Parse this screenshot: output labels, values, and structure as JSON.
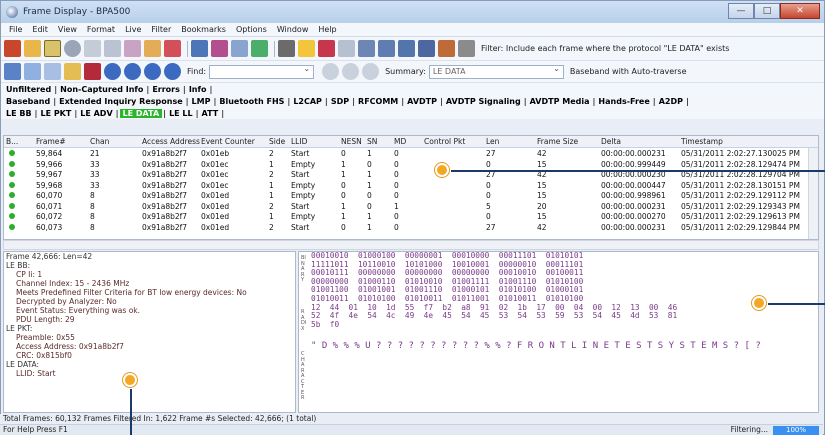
{
  "window": {
    "title": "Frame Display - BPA500"
  },
  "menu": [
    "File",
    "Edit",
    "View",
    "Format",
    "Live",
    "Filter",
    "Bookmarks",
    "Options",
    "Window",
    "Help"
  ],
  "toolbar": {
    "filter_text": "Filter: Include each frame where the protocol \"LE DATA\" exists",
    "find_label": "Find:",
    "summary_label": "Summary:",
    "summary_value": "LE DATA",
    "baseband_text": "Baseband with Auto-traverse"
  },
  "tabs_row1": [
    "Unfiltered",
    "Non-Captured Info",
    "Errors",
    "Info"
  ],
  "tabs_row2": [
    "Baseband",
    "Extended Inquiry Response",
    "LMP",
    "Bluetooth FHS",
    "L2CAP",
    "SDP",
    "RFCOMM",
    "AVDTP",
    "AVDTP Signaling",
    "AVDTP Media",
    "Hands-Free",
    "A2DP"
  ],
  "tabs_row3": [
    "LE BB",
    "LE PKT",
    "LE ADV",
    "LE DATA",
    "LE LL",
    "ATT"
  ],
  "tabs_row3_active": "LE DATA",
  "grid": {
    "columns": [
      "B...",
      "Frame#",
      "Chan",
      "Access Address",
      "Event Counter",
      "Side",
      "LLID",
      "NESN",
      "SN",
      "MD",
      "Control Pkt",
      "Len",
      "Frame Size",
      "Delta",
      "Timestamp"
    ],
    "rows": [
      [
        "59,864",
        "21",
        "0x91a8b2f7",
        "0x01eb",
        "2",
        "Start",
        "0",
        "1",
        "0",
        "",
        "27",
        "42",
        "00:00:00.000231",
        "05/31/2011 2:02:27.130025 PM"
      ],
      [
        "59,966",
        "33",
        "0x91a8b2f7",
        "0x01ec",
        "1",
        "Empty",
        "1",
        "0",
        "0",
        "",
        "0",
        "15",
        "00:00:00.999449",
        "05/31/2011 2:02:28.129474 PM"
      ],
      [
        "59,967",
        "33",
        "0x91a8b2f7",
        "0x01ec",
        "2",
        "Start",
        "1",
        "1",
        "0",
        "",
        "27",
        "42",
        "00:00:00.000230",
        "05/31/2011 2:02:28.129704 PM"
      ],
      [
        "59,968",
        "33",
        "0x91a8b2f7",
        "0x01ec",
        "1",
        "Empty",
        "0",
        "1",
        "0",
        "",
        "0",
        "15",
        "00:00:00.000447",
        "05/31/2011 2:02:28.130151 PM"
      ],
      [
        "60,070",
        "8",
        "0x91a8b2f7",
        "0x01ed",
        "1",
        "Empty",
        "0",
        "0",
        "0",
        "",
        "0",
        "15",
        "00:00:00.998961",
        "05/31/2011 2:02:29.129112 PM"
      ],
      [
        "60,071",
        "8",
        "0x91a8b2f7",
        "0x01ed",
        "2",
        "Start",
        "1",
        "0",
        "1",
        "",
        "5",
        "20",
        "00:00:00.000231",
        "05/31/2011 2:02:29.129343 PM"
      ],
      [
        "60,072",
        "8",
        "0x91a8b2f7",
        "0x01ed",
        "1",
        "Empty",
        "1",
        "1",
        "0",
        "",
        "0",
        "15",
        "00:00:00.000270",
        "05/31/2011 2:02:29.129613 PM"
      ],
      [
        "60,073",
        "8",
        "0x91a8b2f7",
        "0x01ed",
        "2",
        "Start",
        "0",
        "1",
        "0",
        "",
        "27",
        "42",
        "00:00:00.000231",
        "05/31/2011 2:02:29.129844 PM"
      ]
    ]
  },
  "tree": [
    {
      "lvl": "l1",
      "text": "Frame 42,666:  Len=42"
    },
    {
      "lvl": "l1",
      "text": "LE BB:"
    },
    {
      "lvl": "l2",
      "text": "CP Ii: 1"
    },
    {
      "lvl": "l2",
      "text": "Channel Index: 15 - 2436 MHz"
    },
    {
      "lvl": "l2",
      "text": "Meets Predefined Filter Criteria for BT low energy devices: No"
    },
    {
      "lvl": "l2",
      "text": "Decrypted by Analyzer: No"
    },
    {
      "lvl": "l2",
      "text": "Event Status: Everything was ok."
    },
    {
      "lvl": "l2",
      "text": "PDU Length: 29"
    },
    {
      "lvl": "l1",
      "text": "LE PKT:"
    },
    {
      "lvl": "l2",
      "text": "Preamble: 0x55"
    },
    {
      "lvl": "l2",
      "text": "Access Address: 0x91a8b2f7"
    },
    {
      "lvl": "l2",
      "text": "CRC: 0x815bf0"
    },
    {
      "lvl": "l1",
      "text": "LE DATA:"
    },
    {
      "lvl": "l2",
      "text": "LLID: Start"
    }
  ],
  "hex": {
    "lines": [
      "00010010  01000100  00000001  00010000  00011101  01010101",
      "11111011  10110010  10101000  10010001  00000010  00011101",
      "00010111  00000000  00000000  00000000  00010010  00100011",
      "00000000  01000110  01010010  01001111  01001110  01010100",
      "01001100  01001001  01001110  01000101  01010100  01000101",
      "01010011  01010100  01010011  01011001  01010011  01010100",
      "12  44  01  10  1d  55  f7  b2  a8  91  02  1b  17  00  04  00  12  13  00  46",
      "52  4f  4e  54  4c  49  4e  45  54  45  53  54  53  59  53  54  45  4d  53  81",
      "5b  f0"
    ],
    "ascii": "\" D % % % U ? ? ? ? ? ? ? ? ? ? % % ? F R O N T L I N E T E S T S Y S T E M S ? [ ?",
    "side_label_1": "BINARY",
    "side_label_2": "RADIX",
    "side_label_3": "CHARACTER"
  },
  "status": "Total Frames: 60,132   Frames Filtered In: 1,622   Frame #s Selected: 42,666; (1 total)",
  "help": "For Help Press F1",
  "filtering": "Filtering...",
  "progress_pct": "100%"
}
